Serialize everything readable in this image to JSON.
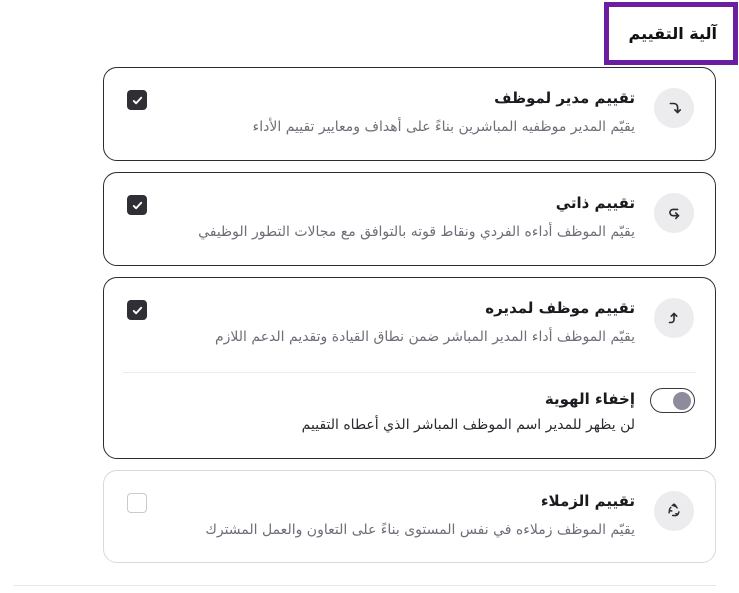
{
  "section": {
    "title": "آلية التقييم"
  },
  "cards": [
    {
      "title": "تقييم مدير لموظف",
      "description": "يقيّم المدير موظفيه المباشرين بناءً على أهداف ومعايير تقييم الأداء",
      "checked": true,
      "icon": "arrow-turn-down-left-icon"
    },
    {
      "title": "تقييم ذاتي",
      "description": "يقيّم الموظف أداءه الفردي ونقاط قوته بالتوافق مع مجالات التطور الوظيفي",
      "checked": true,
      "icon": "arrow-return-left-icon"
    },
    {
      "title": "تقييم موظف لمديره",
      "description": "يقيّم الموظف أداء المدير المباشر ضمن نطاق القيادة وتقديم الدعم اللازم",
      "checked": true,
      "icon": "arrow-turn-up-icon",
      "anonymity": {
        "title": "إخفاء الهوية",
        "description": "لن يظهر للمدير اسم الموظف المباشر الذي أعطاه التقييم",
        "enabled": false
      }
    },
    {
      "title": "تقييم الزملاء",
      "description": "يقيّم الموظف زملاءه في نفس المستوى بناءً على التعاون والعمل المشترك",
      "checked": false,
      "icon": "recycle-arrows-icon"
    }
  ],
  "colors": {
    "accent_border": "#6b1fa0",
    "checkbox_checked": "#2f2f35",
    "icon_bg": "#ececee",
    "toggle_knob": "#8e8c9c"
  }
}
